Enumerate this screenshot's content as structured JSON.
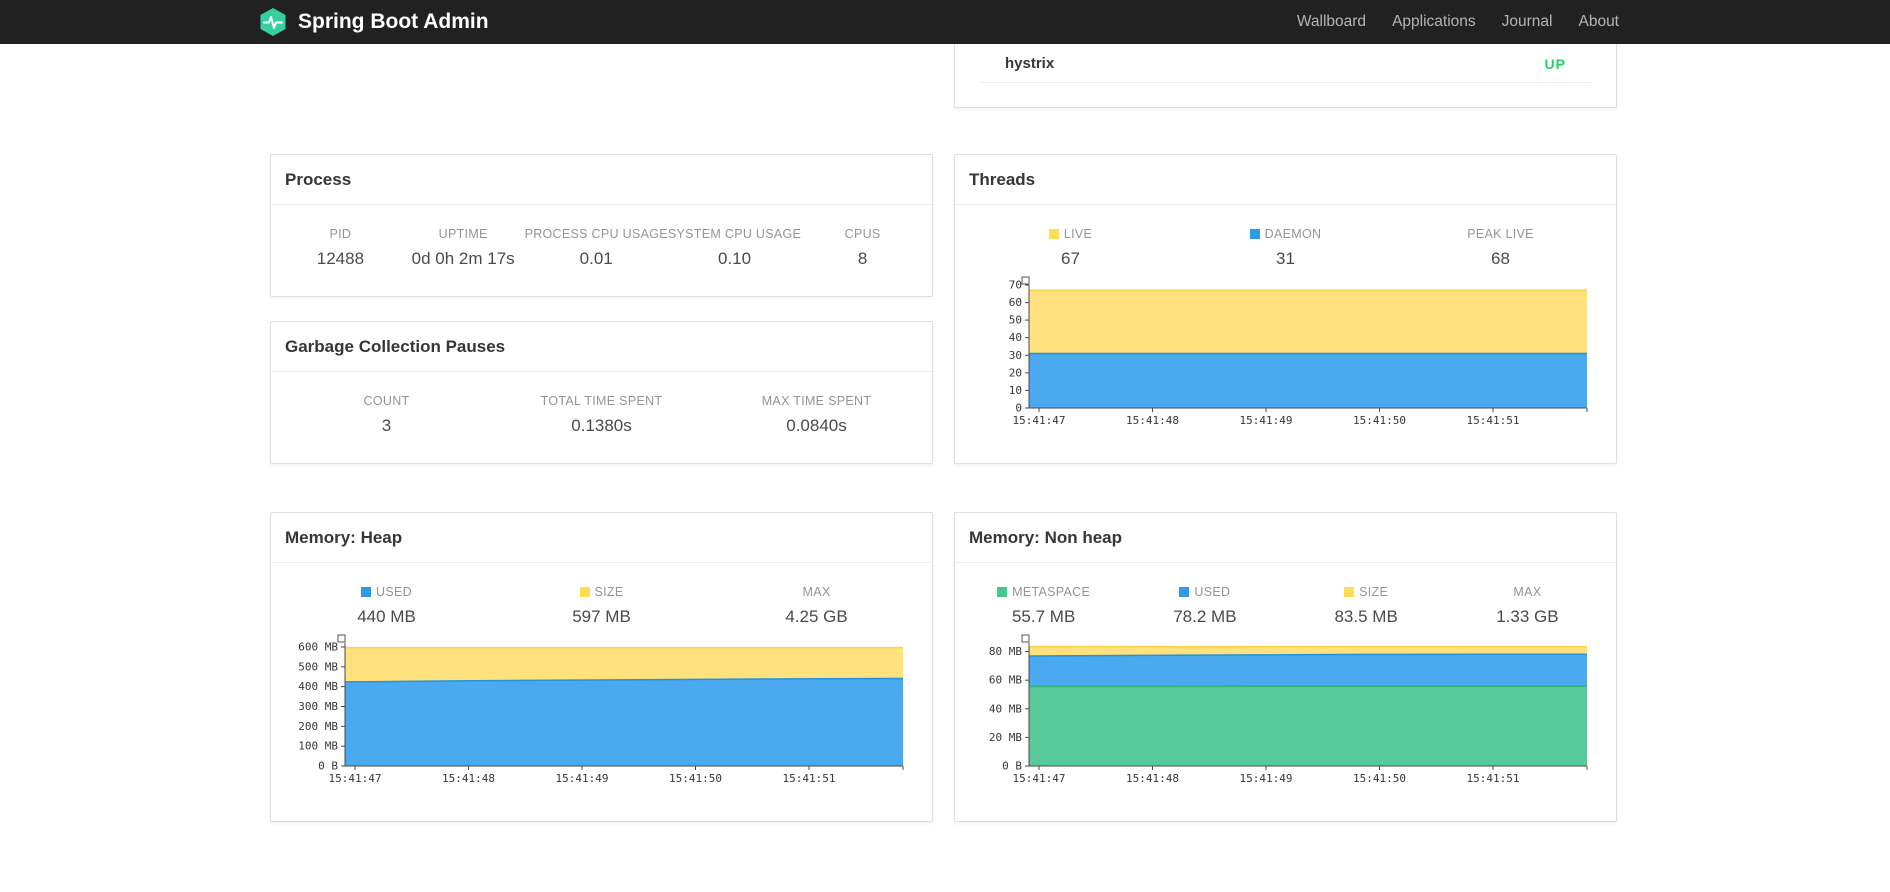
{
  "navbar": {
    "brand": "Spring Boot Admin",
    "items": [
      "Wallboard",
      "Applications",
      "Journal",
      "About"
    ]
  },
  "status_card": {
    "service_name": "hystrix",
    "status": "UP",
    "status_color": "#23d160"
  },
  "process_card": {
    "title": "Process",
    "stats": [
      {
        "label": "PID",
        "value": "12488"
      },
      {
        "label": "UPTIME",
        "value": "0d 0h 2m 17s"
      },
      {
        "label": "PROCESS CPU USAGE",
        "value": "0.01"
      },
      {
        "label": "SYSTEM CPU USAGE",
        "value": "0.10"
      },
      {
        "label": "CPUS",
        "value": "8"
      }
    ]
  },
  "gc_card": {
    "title": "Garbage Collection Pauses",
    "stats": [
      {
        "label": "COUNT",
        "value": "3"
      },
      {
        "label": "TOTAL TIME SPENT",
        "value": "0.1380s"
      },
      {
        "label": "MAX TIME SPENT",
        "value": "0.0840s"
      }
    ]
  },
  "threads_card": {
    "title": "Threads",
    "stats": [
      {
        "label": "LIVE",
        "value": "67",
        "swatch": "#ffdd57"
      },
      {
        "label": "DAEMON",
        "value": "31",
        "swatch": "#2d9ce5"
      },
      {
        "label": "PEAK LIVE",
        "value": "68"
      }
    ]
  },
  "heap_card": {
    "title": "Memory: Heap",
    "stats": [
      {
        "label": "USED",
        "value": "440 MB",
        "swatch": "#2d9ce5"
      },
      {
        "label": "SIZE",
        "value": "597 MB",
        "swatch": "#ffdd57"
      },
      {
        "label": "MAX",
        "value": "4.25 GB"
      }
    ]
  },
  "nonheap_card": {
    "title": "Memory: Non heap",
    "stats": [
      {
        "label": "METASPACE",
        "value": "55.7 MB",
        "swatch": "#47c78e"
      },
      {
        "label": "USED",
        "value": "78.2 MB",
        "swatch": "#2d9ce5"
      },
      {
        "label": "SIZE",
        "value": "83.5 MB",
        "swatch": "#ffdd57"
      },
      {
        "label": "MAX",
        "value": "1.33 GB"
      }
    ]
  },
  "chart_data": [
    {
      "id": "threads",
      "type": "area",
      "title": "Threads",
      "x_labels": [
        "15:41:47",
        "15:41:48",
        "15:41:49",
        "15:41:50",
        "15:41:51"
      ],
      "ymax": 70,
      "yticks": [
        {
          "value": 0,
          "label": "0"
        },
        {
          "value": 10,
          "label": "10"
        },
        {
          "value": 20,
          "label": "20"
        },
        {
          "value": 30,
          "label": "30"
        },
        {
          "value": 40,
          "label": "40"
        },
        {
          "value": 50,
          "label": "50"
        },
        {
          "value": 60,
          "label": "60"
        },
        {
          "value": 70,
          "label": "70"
        }
      ],
      "series": [
        {
          "name": "LIVE",
          "fill": "#ffe27d",
          "stroke": "#fdd34c",
          "values": [
            67,
            67,
            67,
            67,
            67,
            67
          ]
        },
        {
          "name": "DAEMON",
          "fill": "#4aa9ef",
          "stroke": "#2492dd",
          "values": [
            31,
            31,
            31,
            31,
            31,
            31
          ]
        }
      ]
    },
    {
      "id": "heap",
      "type": "area",
      "title": "Memory: Heap",
      "x_labels": [
        "15:41:47",
        "15:41:48",
        "15:41:49",
        "15:41:50",
        "15:41:51"
      ],
      "ymax": 620,
      "yticks": [
        {
          "value": 0,
          "label": "0 B"
        },
        {
          "value": 100,
          "label": "100 MB"
        },
        {
          "value": 200,
          "label": "200 MB"
        },
        {
          "value": 300,
          "label": "300 MB"
        },
        {
          "value": 400,
          "label": "400 MB"
        },
        {
          "value": 500,
          "label": "500 MB"
        },
        {
          "value": 600,
          "label": "600 MB"
        }
      ],
      "series": [
        {
          "name": "SIZE",
          "fill": "#ffe27d",
          "stroke": "#fdd34c",
          "values": [
            597,
            597,
            597,
            597,
            597,
            597
          ]
        },
        {
          "name": "USED",
          "fill": "#4aa9ef",
          "stroke": "#2492dd",
          "values": [
            424,
            429,
            433,
            436,
            439,
            441
          ]
        }
      ]
    },
    {
      "id": "nonheap",
      "type": "area",
      "title": "Memory: Non heap",
      "x_labels": [
        "15:41:47",
        "15:41:48",
        "15:41:49",
        "15:41:50",
        "15:41:51"
      ],
      "ymax": 86,
      "yticks": [
        {
          "value": 0,
          "label": "0 B"
        },
        {
          "value": 20,
          "label": "20 MB"
        },
        {
          "value": 40,
          "label": "40 MB"
        },
        {
          "value": 60,
          "label": "60 MB"
        },
        {
          "value": 80,
          "label": "80 MB"
        }
      ],
      "series": [
        {
          "name": "SIZE",
          "fill": "#ffe27d",
          "stroke": "#fdd34c",
          "values": [
            83.5,
            83.5,
            83.5,
            83.5,
            83.5,
            83.5
          ]
        },
        {
          "name": "USED",
          "fill": "#4aa9ef",
          "stroke": "#2492dd",
          "values": [
            76.9,
            77.3,
            77.7,
            78.0,
            78.1,
            78.2
          ]
        },
        {
          "name": "METASPACE",
          "fill": "#58c99b",
          "stroke": "#2fb579",
          "values": [
            55.6,
            55.6,
            55.7,
            55.7,
            55.7,
            55.7
          ]
        }
      ]
    }
  ]
}
